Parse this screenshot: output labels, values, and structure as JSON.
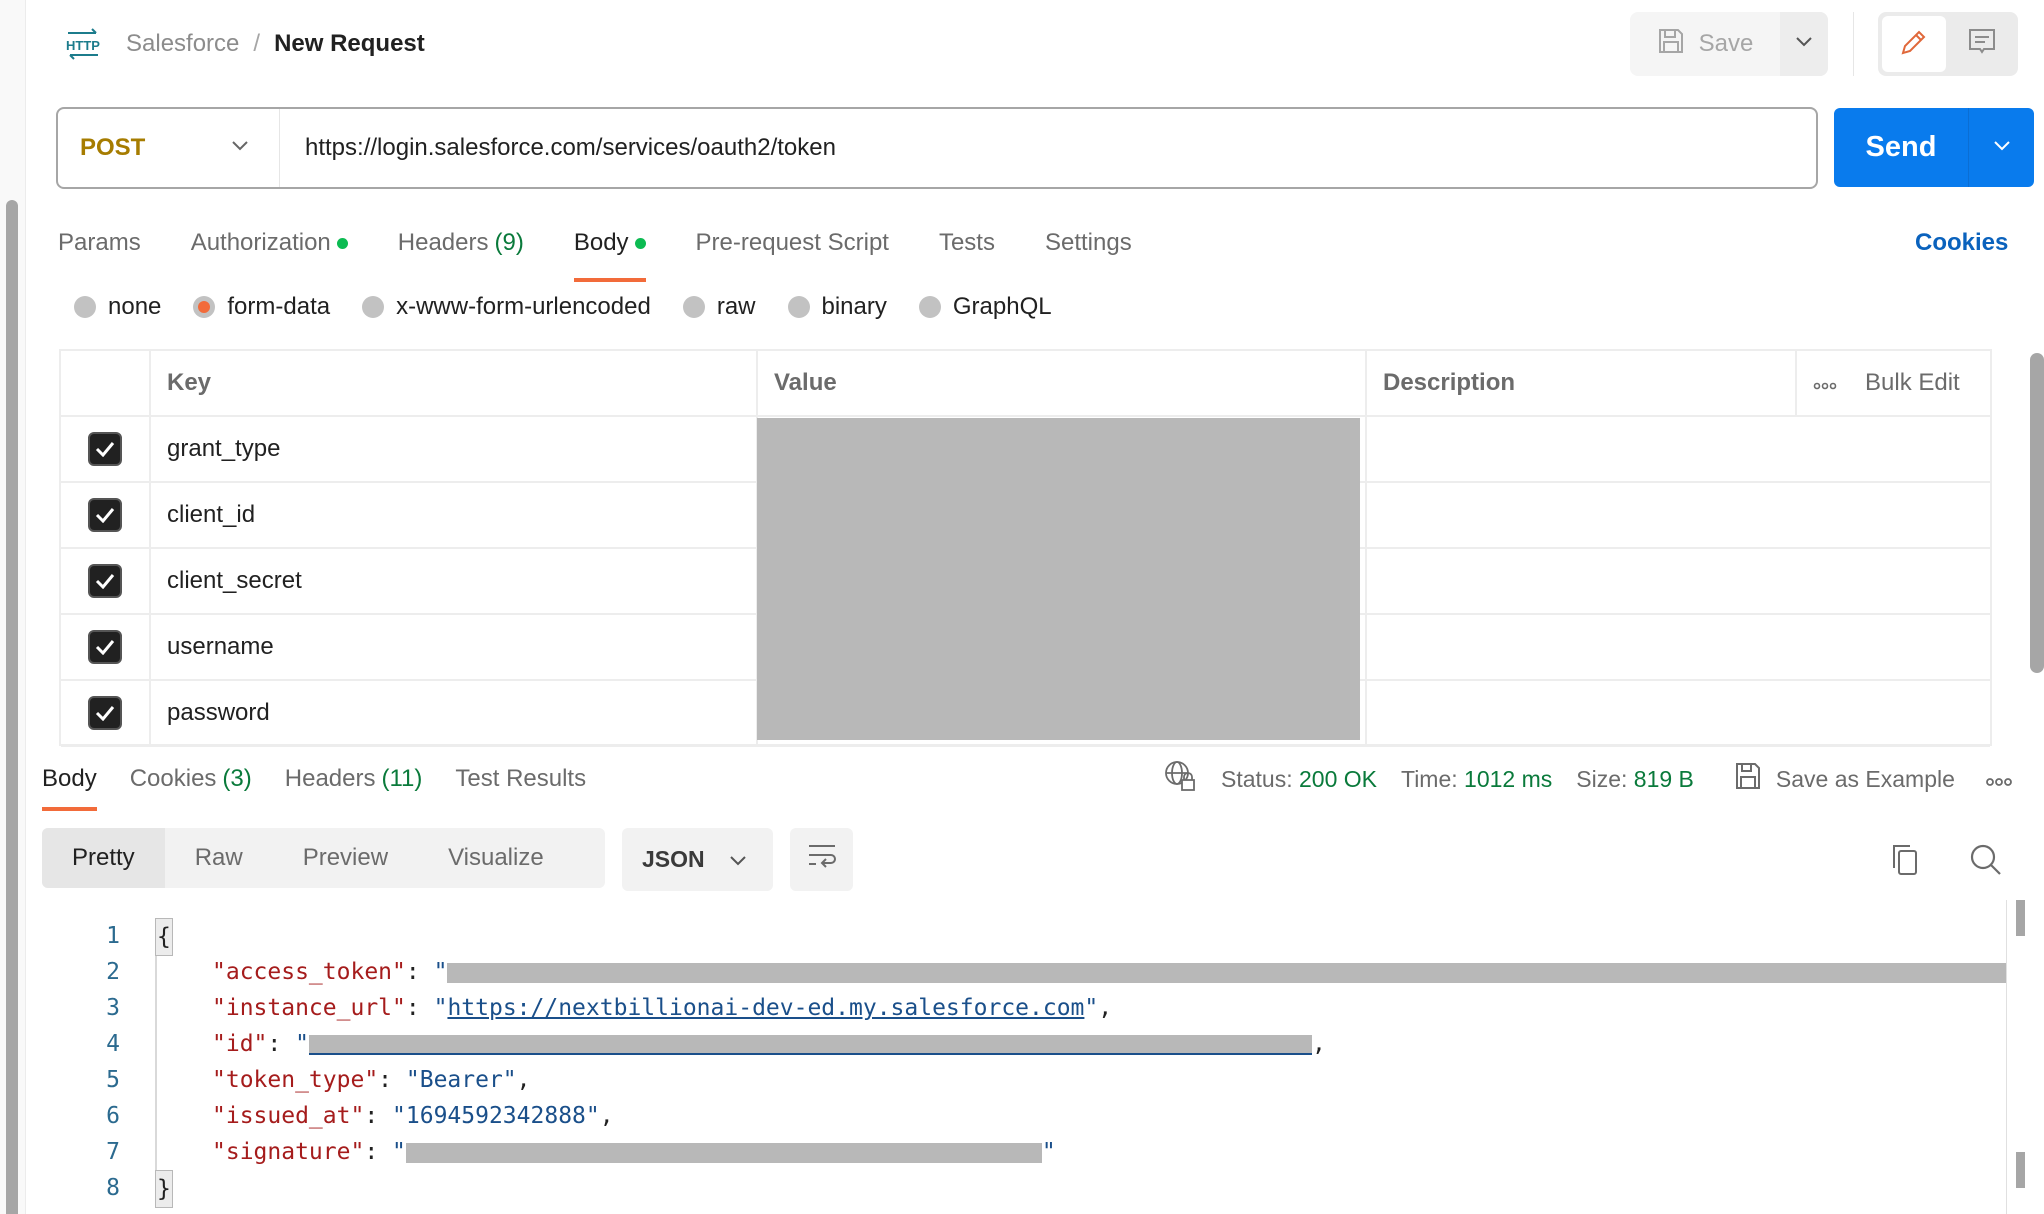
{
  "header": {
    "breadcrumb_parent": "Salesforce",
    "breadcrumb_separator": "/",
    "breadcrumb_current": "New Request",
    "save_label": "Save"
  },
  "request": {
    "method": "POST",
    "url": "https://login.salesforce.com/services/oauth2/token",
    "send_label": "Send"
  },
  "request_tabs": [
    {
      "label": "Params",
      "count": "",
      "dot": false,
      "active": false
    },
    {
      "label": "Authorization",
      "count": "",
      "dot": true,
      "active": false
    },
    {
      "label": "Headers",
      "count": "(9)",
      "dot": false,
      "active": false
    },
    {
      "label": "Body",
      "count": "",
      "dot": true,
      "active": true
    },
    {
      "label": "Pre-request Script",
      "count": "",
      "dot": false,
      "active": false
    },
    {
      "label": "Tests",
      "count": "",
      "dot": false,
      "active": false
    },
    {
      "label": "Settings",
      "count": "",
      "dot": false,
      "active": false
    }
  ],
  "cookies_link": "Cookies",
  "body_types": [
    {
      "label": "none",
      "checked": false
    },
    {
      "label": "form-data",
      "checked": true
    },
    {
      "label": "x-www-form-urlencoded",
      "checked": false
    },
    {
      "label": "raw",
      "checked": false
    },
    {
      "label": "binary",
      "checked": false
    },
    {
      "label": "GraphQL",
      "checked": false
    }
  ],
  "params_table": {
    "headers": {
      "key": "Key",
      "value": "Value",
      "description": "Description",
      "bulk_edit": "Bulk Edit"
    },
    "rows": [
      {
        "checked": true,
        "key": "grant_type",
        "value": "[redacted]",
        "description": ""
      },
      {
        "checked": true,
        "key": "client_id",
        "value": "[redacted]",
        "description": ""
      },
      {
        "checked": true,
        "key": "client_secret",
        "value": "[redacted]",
        "description": ""
      },
      {
        "checked": true,
        "key": "username",
        "value": "[redacted]",
        "description": ""
      },
      {
        "checked": true,
        "key": "password",
        "value": "[redacted]",
        "description": ""
      }
    ]
  },
  "response": {
    "tabs": [
      {
        "label": "Body",
        "count": "",
        "active": true
      },
      {
        "label": "Cookies",
        "count": "(3)",
        "active": false
      },
      {
        "label": "Headers",
        "count": "(11)",
        "active": false
      },
      {
        "label": "Test Results",
        "count": "",
        "active": false
      }
    ],
    "status_label": "Status:",
    "status_value": "200 OK",
    "time_label": "Time:",
    "time_value": "1012 ms",
    "size_label": "Size:",
    "size_value": "819 B",
    "save_example_label": "Save as Example",
    "views": [
      "Pretty",
      "Raw",
      "Preview",
      "Visualize"
    ],
    "active_view": "Pretty",
    "format": "JSON",
    "colors": {
      "status_ok": "#0a7a3b",
      "accent": "#f26b3a",
      "send": "#097bed"
    },
    "code_lines": [
      {
        "n": "1",
        "open": "{"
      },
      {
        "n": "2",
        "key": "\"access_token\"",
        "value": "[redacted]"
      },
      {
        "n": "3",
        "key": "\"instance_url\"",
        "value": "https://nextbillionai-dev-ed.my.salesforce.com"
      },
      {
        "n": "4",
        "key": "\"id\"",
        "value": "[redacted]"
      },
      {
        "n": "5",
        "key": "\"token_type\"",
        "value": "\"Bearer\""
      },
      {
        "n": "6",
        "key": "\"issued_at\"",
        "value": "\"1694592342888\""
      },
      {
        "n": "7",
        "key": "\"signature\"",
        "value": "[redacted]"
      },
      {
        "n": "8",
        "close": "}"
      }
    ]
  }
}
